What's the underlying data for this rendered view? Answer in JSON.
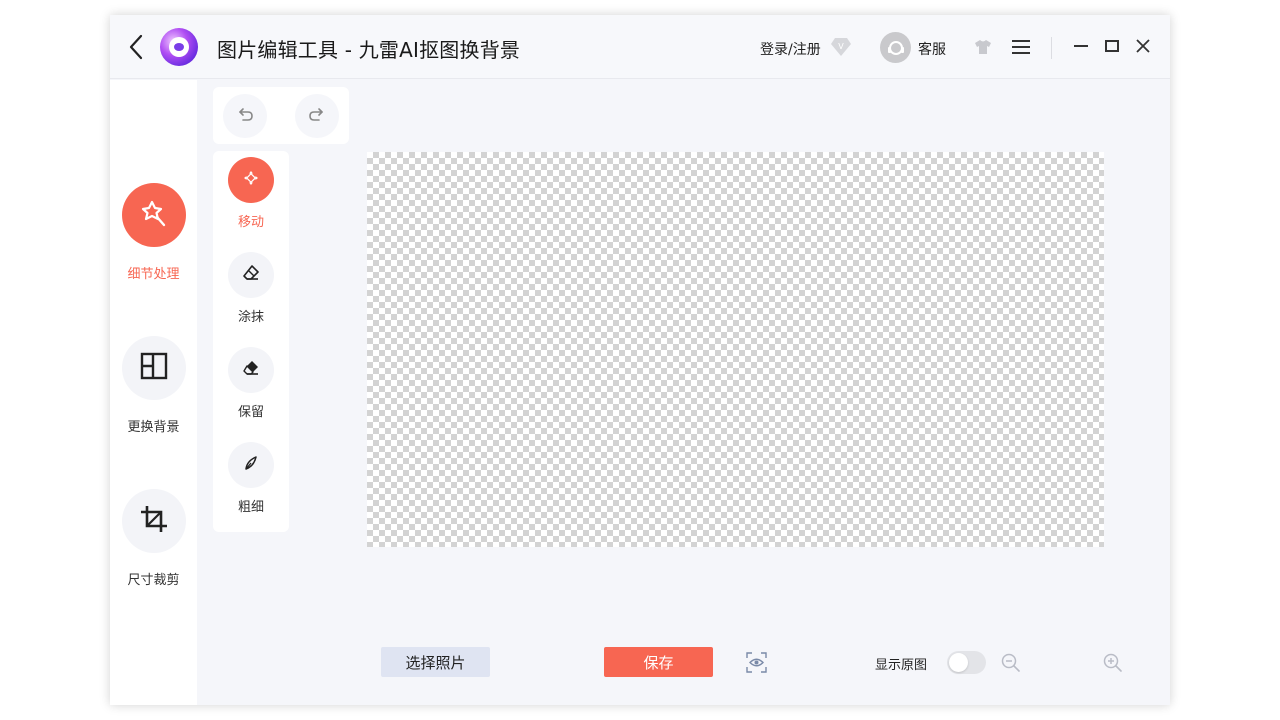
{
  "titlebar": {
    "title": "图片编辑工具 - 九雷AI抠图换背景",
    "login_label": "登录/注册",
    "vip_badge": "V",
    "service_label": "客服"
  },
  "sidebar": {
    "items": [
      {
        "label": "细节处理",
        "icon": "sparkle-wand-icon",
        "active": true
      },
      {
        "label": "更换背景",
        "icon": "layout-panel-icon",
        "active": false
      },
      {
        "label": "尺寸裁剪",
        "icon": "crop-icon",
        "active": false
      }
    ]
  },
  "tools": {
    "items": [
      {
        "label": "移动",
        "icon": "move-icon",
        "active": true
      },
      {
        "label": "涂抹",
        "icon": "eraser-outline-icon",
        "active": false
      },
      {
        "label": "保留",
        "icon": "eraser-filled-icon",
        "active": false
      },
      {
        "label": "粗细",
        "icon": "brush-size-icon",
        "active": false
      }
    ]
  },
  "bottom": {
    "select_photo_label": "选择照片",
    "save_label": "保存",
    "show_original_label": "显示原图",
    "show_original_on": false
  },
  "colors": {
    "accent": "#f76652",
    "canvas_checker": "#d3d3d3",
    "window_bg": "#f5f6fa"
  }
}
